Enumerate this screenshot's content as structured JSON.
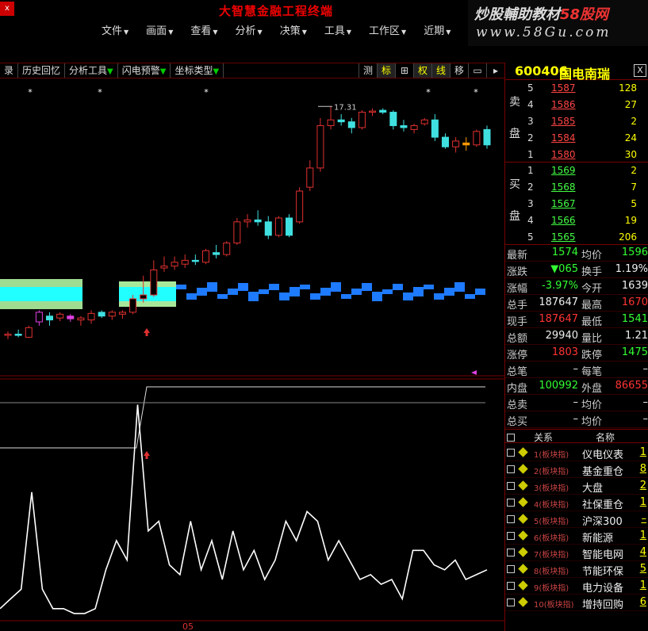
{
  "window": {
    "close_label": "x",
    "title": "大智慧金融工程终端"
  },
  "menu": [
    {
      "label": "文件"
    },
    {
      "label": "画面"
    },
    {
      "label": "查看"
    },
    {
      "label": "分析"
    },
    {
      "label": "决策"
    },
    {
      "label": "工具"
    },
    {
      "label": "工作区"
    },
    {
      "label": "近期"
    }
  ],
  "menu_arrow": "▼",
  "logo": {
    "line1_a": "炒股輔助教材",
    "line1_b": "58股网",
    "line2": "www.58Gu.com"
  },
  "toolbar": {
    "items": [
      "录",
      "历史回忆",
      "分析工具",
      "闪电预警",
      "坐标类型"
    ],
    "dropdown_glyph": "▼",
    "right_buttons": [
      "测",
      "标",
      "⊞",
      "权",
      "线",
      "移",
      "▭",
      "▸"
    ]
  },
  "stock": {
    "code": "600406",
    "name": "国电南瑞",
    "close": "X"
  },
  "orderbook": {
    "sell_label_top": "卖",
    "sell_label_bottom": "盘",
    "buy_label_top": "买",
    "buy_label_bottom": "盘",
    "sell": [
      {
        "level": "5",
        "price": "1587",
        "volume": "128"
      },
      {
        "level": "4",
        "price": "1586",
        "volume": "27"
      },
      {
        "level": "3",
        "price": "1585",
        "volume": "2"
      },
      {
        "level": "2",
        "price": "1584",
        "volume": "24"
      },
      {
        "level": "1",
        "price": "1580",
        "volume": "30"
      }
    ],
    "buy": [
      {
        "level": "1",
        "price": "1569",
        "volume": "2"
      },
      {
        "level": "2",
        "price": "1568",
        "volume": "7"
      },
      {
        "level": "3",
        "price": "1567",
        "volume": "5"
      },
      {
        "level": "4",
        "price": "1566",
        "volume": "19"
      },
      {
        "level": "5",
        "price": "1565",
        "volume": "206"
      }
    ],
    "sell_color": "#ff4444",
    "buy_color": "#44ff44"
  },
  "quote": [
    {
      "l1": "最新",
      "v1": "1574",
      "c1": "green",
      "l2": "均价",
      "v2": "1596",
      "c2": "green"
    },
    {
      "l1": "涨跌",
      "v1": "▼065",
      "c1": "green",
      "l2": "换手",
      "v2": "1.19%",
      "c2": "white"
    },
    {
      "l1": "涨幅",
      "v1": "-3.97%",
      "c1": "green",
      "l2": "今开",
      "v2": "1639",
      "c2": "white"
    },
    {
      "l1": "总手",
      "v1": "187647",
      "c1": "white",
      "l2": "最高",
      "v2": "1670",
      "c2": "red"
    },
    {
      "l1": "现手",
      "v1": "187647",
      "c1": "red",
      "l2": "最低",
      "v2": "1541",
      "c2": "green"
    },
    {
      "l1": "总额",
      "v1": "29940",
      "c1": "white",
      "l2": "量比",
      "v2": "1.21",
      "c2": "white"
    },
    {
      "l1": "涨停",
      "v1": "1803",
      "c1": "red",
      "l2": "跌停",
      "v2": "1475",
      "c2": "green"
    },
    {
      "l1": "总笔",
      "v1": "–",
      "c1": "white",
      "l2": "每笔",
      "v2": "–",
      "c2": "white"
    },
    {
      "l1": "内盘",
      "v1": "100992",
      "c1": "green",
      "l2": "外盘",
      "v2": "86655",
      "c2": "red"
    },
    {
      "l1": "总卖",
      "v1": "–",
      "c1": "white",
      "l2": "均价",
      "v2": "–",
      "c2": "white"
    },
    {
      "l1": "总买",
      "v1": "–",
      "c1": "white",
      "l2": "均价",
      "v2": "–",
      "c2": "white"
    }
  ],
  "related": {
    "col_relation": "关系",
    "col_name": "名称",
    "rows": [
      {
        "idx": "1(板块指)",
        "name": "仪电仪表",
        "val": "1"
      },
      {
        "idx": "2(板块指)",
        "name": "基金重仓",
        "val": "8"
      },
      {
        "idx": "3(板块指)",
        "name": "大盘",
        "val": "2"
      },
      {
        "idx": "4(板块指)",
        "name": "社保重仓",
        "val": "1"
      },
      {
        "idx": "5(板块指)",
        "name": "沪深300",
        "val": "–"
      },
      {
        "idx": "6(板块指)",
        "name": "新能源",
        "val": "1"
      },
      {
        "idx": "7(板块指)",
        "name": "智能电网",
        "val": "4"
      },
      {
        "idx": "8(板块指)",
        "name": "节能环保",
        "val": "5"
      },
      {
        "idx": "9(板块指)",
        "name": "电力设备",
        "val": "1"
      },
      {
        "idx": "10(板块指)",
        "name": "增持回购",
        "val": "6"
      }
    ]
  },
  "chart_data": {
    "type": "candlestick",
    "high_label": "17.31",
    "x_label_visible": "05",
    "price_range": [
      11.0,
      17.8
    ],
    "candles": [
      {
        "o": 11.35,
        "h": 11.45,
        "l": 11.25,
        "c": 11.38
      },
      {
        "o": 11.38,
        "h": 11.5,
        "l": 11.3,
        "c": 11.35
      },
      {
        "o": 11.3,
        "h": 11.6,
        "l": 11.28,
        "c": 11.55
      },
      {
        "o": 11.7,
        "h": 12.0,
        "l": 11.6,
        "c": 11.95
      },
      {
        "o": 11.85,
        "h": 11.95,
        "l": 11.6,
        "c": 11.75
      },
      {
        "o": 11.8,
        "h": 11.95,
        "l": 11.72,
        "c": 11.9
      },
      {
        "o": 11.85,
        "h": 11.9,
        "l": 11.7,
        "c": 11.78
      },
      {
        "o": 11.75,
        "h": 11.85,
        "l": 11.6,
        "c": 11.8
      },
      {
        "o": 11.75,
        "h": 12.0,
        "l": 11.65,
        "c": 11.92
      },
      {
        "o": 11.95,
        "h": 12.0,
        "l": 11.8,
        "c": 11.85
      },
      {
        "o": 11.85,
        "h": 12.0,
        "l": 11.75,
        "c": 11.95
      },
      {
        "o": 11.9,
        "h": 12.0,
        "l": 11.78,
        "c": 11.95
      },
      {
        "o": 11.95,
        "h": 12.4,
        "l": 11.9,
        "c": 12.3
      },
      {
        "o": 12.3,
        "h": 12.9,
        "l": 12.2,
        "c": 12.4
      },
      {
        "o": 12.4,
        "h": 13.3,
        "l": 12.35,
        "c": 13.05
      },
      {
        "o": 13.1,
        "h": 13.4,
        "l": 13.0,
        "c": 13.15
      },
      {
        "o": 13.15,
        "h": 13.4,
        "l": 13.05,
        "c": 13.25
      },
      {
        "o": 13.2,
        "h": 13.45,
        "l": 13.1,
        "c": 13.3
      },
      {
        "o": 13.3,
        "h": 13.45,
        "l": 13.18,
        "c": 13.28
      },
      {
        "o": 13.25,
        "h": 13.6,
        "l": 13.2,
        "c": 13.55
      },
      {
        "o": 13.5,
        "h": 13.7,
        "l": 13.35,
        "c": 13.45
      },
      {
        "o": 13.45,
        "h": 13.8,
        "l": 13.4,
        "c": 13.75
      },
      {
        "o": 13.75,
        "h": 14.4,
        "l": 13.7,
        "c": 14.3
      },
      {
        "o": 14.3,
        "h": 14.5,
        "l": 14.15,
        "c": 14.35
      },
      {
        "o": 14.35,
        "h": 14.6,
        "l": 14.2,
        "c": 14.3
      },
      {
        "o": 14.3,
        "h": 14.45,
        "l": 13.85,
        "c": 13.95
      },
      {
        "o": 13.95,
        "h": 14.45,
        "l": 13.9,
        "c": 14.4
      },
      {
        "o": 14.4,
        "h": 14.5,
        "l": 13.9,
        "c": 13.95
      },
      {
        "o": 14.3,
        "h": 15.2,
        "l": 14.25,
        "c": 15.1
      },
      {
        "o": 15.2,
        "h": 15.9,
        "l": 15.1,
        "c": 15.7
      },
      {
        "o": 15.7,
        "h": 17.0,
        "l": 15.6,
        "c": 16.8
      },
      {
        "o": 16.8,
        "h": 17.3,
        "l": 16.7,
        "c": 16.95
      },
      {
        "o": 16.95,
        "h": 17.1,
        "l": 16.8,
        "c": 16.9
      },
      {
        "o": 16.9,
        "h": 17.0,
        "l": 16.6,
        "c": 16.75
      },
      {
        "o": 16.75,
        "h": 17.2,
        "l": 16.7,
        "c": 17.15
      },
      {
        "o": 17.15,
        "h": 17.25,
        "l": 17.05,
        "c": 17.18
      },
      {
        "o": 17.2,
        "h": 17.25,
        "l": 17.1,
        "c": 17.15
      },
      {
        "o": 17.15,
        "h": 17.2,
        "l": 16.7,
        "c": 16.8
      },
      {
        "o": 16.8,
        "h": 16.95,
        "l": 16.65,
        "c": 16.75
      },
      {
        "o": 16.7,
        "h": 16.85,
        "l": 16.6,
        "c": 16.8
      },
      {
        "o": 16.85,
        "h": 17.0,
        "l": 16.8,
        "c": 16.95
      },
      {
        "o": 16.95,
        "h": 17.1,
        "l": 16.4,
        "c": 16.5
      },
      {
        "o": 16.5,
        "h": 16.6,
        "l": 16.2,
        "c": 16.25
      },
      {
        "o": 16.25,
        "h": 16.5,
        "l": 16.1,
        "c": 16.4
      },
      {
        "o": 16.35,
        "h": 16.5,
        "l": 16.15,
        "c": 16.3
      },
      {
        "o": 16.3,
        "h": 16.7,
        "l": 16.25,
        "c": 16.65
      },
      {
        "o": 16.7,
        "h": 16.8,
        "l": 16.2,
        "c": 16.3
      }
    ],
    "indicator": [
      0.1,
      0.2,
      0.3,
      1.3,
      0.3,
      0.1,
      0.1,
      0.05,
      0.05,
      0.1,
      0.5,
      0.8,
      0.6,
      2.2,
      0.9,
      1.0,
      0.55,
      0.45,
      1.0,
      0.5,
      0.8,
      0.4,
      0.9,
      0.5,
      0.7,
      0.4,
      0.6,
      1.0,
      0.8,
      1.1,
      1.0,
      0.6,
      0.8,
      0.6,
      0.4,
      0.45,
      0.35,
      0.4,
      0.2,
      0.7,
      0.7,
      0.55,
      0.5,
      0.6,
      0.4,
      0.45,
      0.5
    ],
    "indicator_range": [
      0,
      2.4
    ],
    "colors": {
      "up": "#e03030",
      "down": "#40e0e0",
      "orange": "#ff9900",
      "magenta": "#e040e0",
      "band": "#1e7aff",
      "band_light": "#a8e89a",
      "band_cyan": "#22ffff"
    }
  }
}
